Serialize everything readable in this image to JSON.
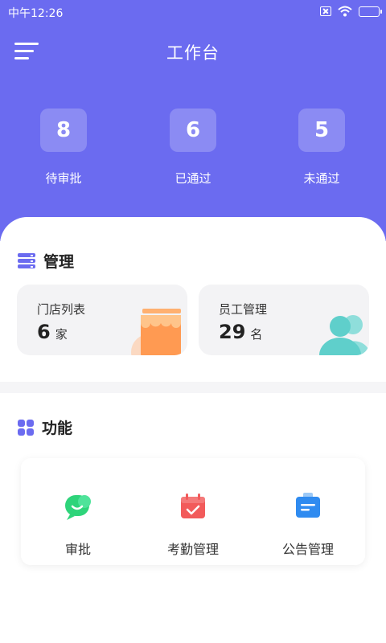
{
  "status_bar": {
    "time": "中午12:26",
    "icons": [
      "sim-off-icon",
      "wifi-icon",
      "battery-charging-icon"
    ]
  },
  "header": {
    "title": "工作台",
    "menu_icon": "menu-icon",
    "accent_color": "#6B6BF0",
    "stats": [
      {
        "value": "8",
        "label": "待审批"
      },
      {
        "value": "6",
        "label": "已通过"
      },
      {
        "value": "5",
        "label": "未通过"
      }
    ]
  },
  "management": {
    "title": "管理",
    "icon": "server-icon",
    "cards": [
      {
        "title": "门店列表",
        "value": "6",
        "unit": "家",
        "icon": "store-icon"
      },
      {
        "title": "员工管理",
        "value": "29",
        "unit": "名",
        "icon": "users-icon"
      }
    ]
  },
  "functions": {
    "title": "功能",
    "icon": "grid-icon",
    "items": [
      {
        "label": "审批",
        "icon": "approval-icon",
        "color": "#2ED47A"
      },
      {
        "label": "考勤管理",
        "icon": "calendar-icon",
        "color": "#F25B5B"
      },
      {
        "label": "公告管理",
        "icon": "notice-icon",
        "color": "#2F8BF0"
      }
    ]
  }
}
